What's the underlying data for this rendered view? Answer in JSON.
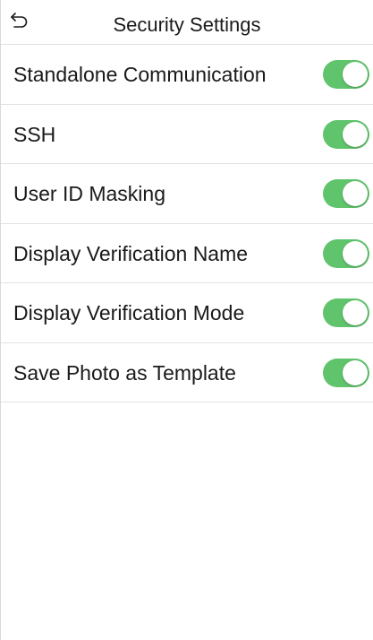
{
  "header": {
    "title": "Security Settings",
    "back_icon": "back-arrow-icon"
  },
  "colors": {
    "toggle_on": "#5fc46b",
    "toggle_off": "#cccccc"
  },
  "settings": [
    {
      "label": "Standalone Communication",
      "enabled": true
    },
    {
      "label": "SSH",
      "enabled": true
    },
    {
      "label": "User ID Masking",
      "enabled": true
    },
    {
      "label": "Display Verification Name",
      "enabled": true
    },
    {
      "label": "Display Verification Mode",
      "enabled": true
    },
    {
      "label": "Save Photo as Template",
      "enabled": true
    }
  ]
}
